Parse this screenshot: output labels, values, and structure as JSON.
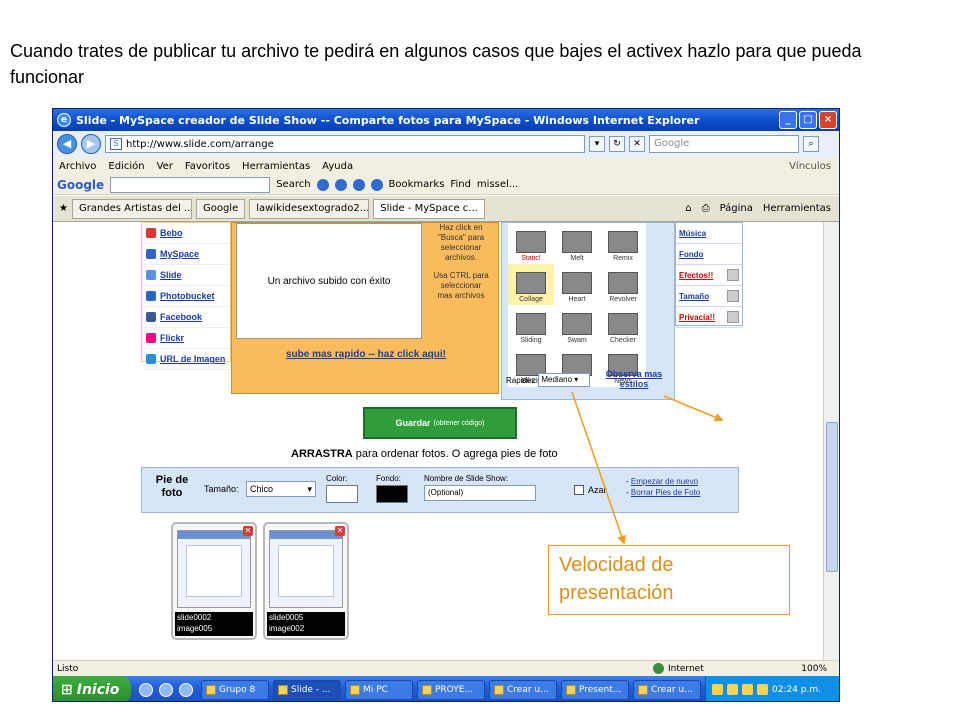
{
  "slide": {
    "caption": "Cuando trates de publicar tu archivo te pedirá en algunos casos que bajes el activex hazlo para que pueda funcionar",
    "callout": "Velocidad de presentación"
  },
  "window": {
    "title": "Slide - MySpace creador de Slide Show -- Comparte fotos para MySpace - Windows Internet Explorer",
    "url": "http://www.slide.com/arrange",
    "search_placeholder": "Google"
  },
  "menu": [
    "Archivo",
    "Edición",
    "Ver",
    "Favoritos",
    "Herramientas",
    "Ayuda"
  ],
  "menu_links": "Vínculos",
  "google_toolbar": {
    "logo": "Google",
    "search": "Search",
    "bookmarks": "Bookmarks",
    "find": "Find",
    "user": "missel..."
  },
  "tabs": [
    "Grandes Artistas del ...",
    "Google",
    "lawikidesextogrado2...",
    "Slide - MySpace c..."
  ],
  "tab_tools": {
    "page": "Página",
    "tools": "Herramientas"
  },
  "sites": [
    "Bebo",
    "MySpace",
    "Slide",
    "Photobucket",
    "Facebook",
    "Flickr",
    "URL de Imagen"
  ],
  "upload": {
    "success": "Un archivo subido con éxito",
    "help_lines": [
      "Haz click en",
      "\"Busca\" para",
      "seleccionar",
      "archivos.",
      "",
      "Usa CTRL para",
      "seleccionar",
      "mas archivos"
    ],
    "fast": "sube mas rapido -- haz click aqui!"
  },
  "styles": [
    {
      "label": "Static!",
      "red": true
    },
    {
      "label": "Melt"
    },
    {
      "label": "Remix"
    },
    {
      "label": "Collage",
      "selected": true
    },
    {
      "label": "Heart"
    },
    {
      "label": "Revolver"
    },
    {
      "label": "Sliding"
    },
    {
      "label": "Swam"
    },
    {
      "label": "Checker"
    },
    {
      "label": "Blinds"
    },
    {
      "label": "Swirl"
    },
    {
      "label": "News"
    }
  ],
  "speed": {
    "label": "Rapidez",
    "value": "Mediano"
  },
  "more_styles": "Observa mas estilos",
  "options": [
    {
      "label": "Música"
    },
    {
      "label": "Fondo"
    },
    {
      "label": "Efectos!!",
      "red": true
    },
    {
      "label": "Tamaño"
    },
    {
      "label": "Privacía!!",
      "red": true
    }
  ],
  "save": {
    "label": "Guardar",
    "sub": "(obtener código)"
  },
  "drag_hint": {
    "bold": "ARRASTRA",
    "rest": " para ordenar fotos. O agrega pies de foto"
  },
  "captions": {
    "title": "Pie de foto",
    "size_label": "Tamaño:",
    "size_value": "Chico",
    "color_label": "Color:",
    "bg_label": "Fondo:",
    "name_label": "Nombre de Slide Show:",
    "name_value": "(Optional)",
    "random_label": "Azar",
    "link_start": "Empezar de nuevo",
    "link_clear": "Borrar Pies de Foto"
  },
  "photos": [
    {
      "name": "slide0002",
      "file": "image005"
    },
    {
      "name": "slide0005",
      "file": "image002"
    }
  ],
  "status": {
    "left": "Listo",
    "zone": "Internet",
    "zoom": "100%"
  },
  "taskbar": {
    "start": "Inicio",
    "tasks": [
      "Grupo 8",
      "Slide - ...",
      "Mi PC",
      "PROYE...",
      "Crear u...",
      "Present...",
      "Crear u..."
    ],
    "clock": "02:24 p.m."
  }
}
